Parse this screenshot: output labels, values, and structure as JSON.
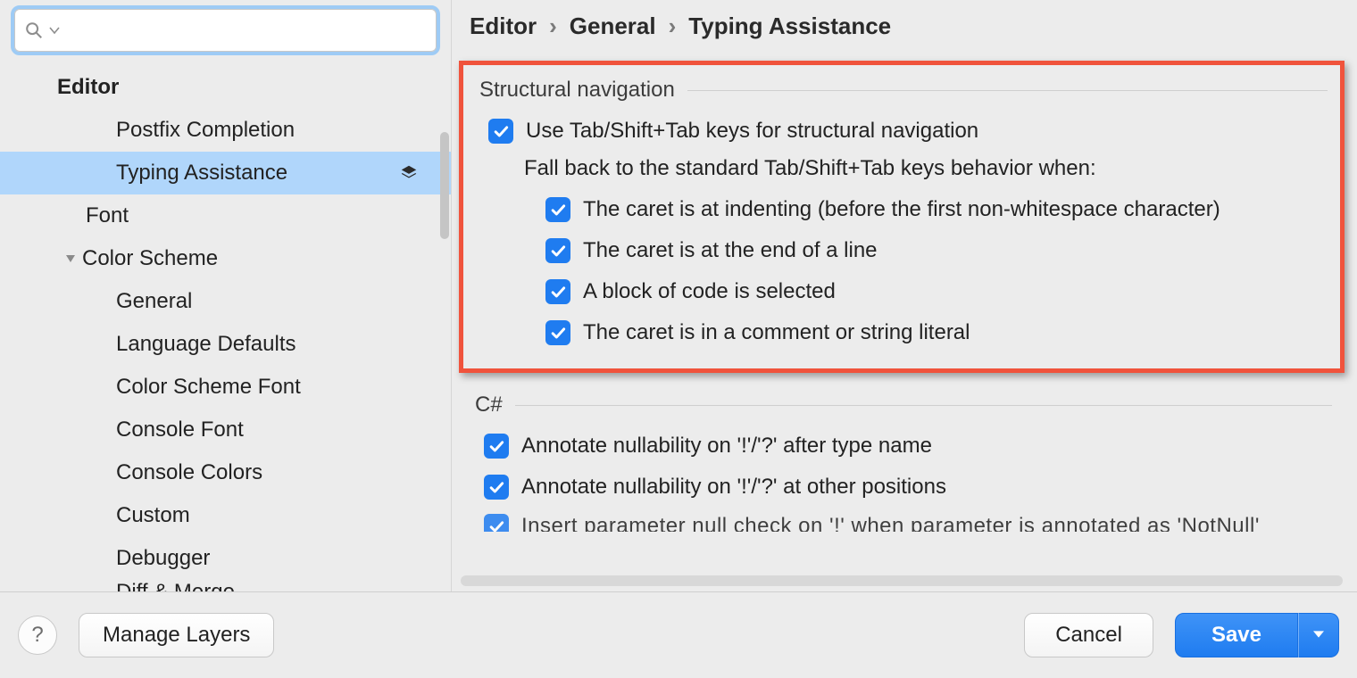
{
  "breadcrumb": {
    "a": "Editor",
    "b": "General",
    "c": "Typing Assistance"
  },
  "sidebar": {
    "search_placeholder": "",
    "items": [
      {
        "label": "Editor"
      },
      {
        "label": "Postfix Completion"
      },
      {
        "label": "Typing Assistance"
      },
      {
        "label": "Font"
      },
      {
        "label": "Color Scheme"
      },
      {
        "label": "General"
      },
      {
        "label": "Language Defaults"
      },
      {
        "label": "Color Scheme Font"
      },
      {
        "label": "Console Font"
      },
      {
        "label": "Console Colors"
      },
      {
        "label": "Custom"
      },
      {
        "label": "Debugger"
      },
      {
        "label": "Diff & Merge"
      }
    ]
  },
  "groups": {
    "structural": {
      "title": "Structural navigation",
      "use_tab": "Use Tab/Shift+Tab keys for structural navigation",
      "fallback_label": "Fall back to the standard Tab/Shift+Tab keys behavior when:",
      "opts": [
        "The caret is at indenting (before the first non-whitespace character)",
        "The caret is at the end of a line",
        "A block of code is selected",
        "The caret is in a comment or string literal"
      ]
    },
    "csharp": {
      "title": "C#",
      "opts": [
        "Annotate nullability on '!'/'?' after type name",
        "Annotate nullability on '!'/'?' at other positions",
        "Insert parameter null check on '!' when parameter is annotated as 'NotNull'"
      ]
    }
  },
  "footer": {
    "help": "?",
    "manage": "Manage Layers",
    "cancel": "Cancel",
    "save": "Save"
  }
}
